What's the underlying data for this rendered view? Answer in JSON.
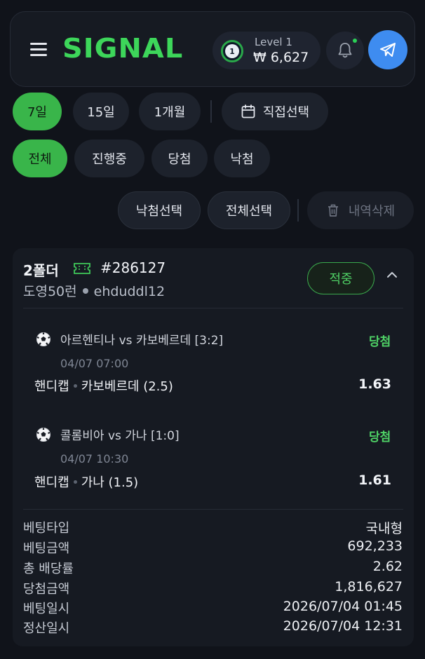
{
  "header": {
    "logo": "SIGNAL",
    "level_badge_number": "1",
    "level": "Level 1",
    "balance": "₩ 6,627",
    "accent_color": "#3dd65a"
  },
  "period_filters": [
    {
      "label": "7일",
      "active": true
    },
    {
      "label": "15일",
      "active": false
    },
    {
      "label": "1개월",
      "active": false
    }
  ],
  "custom_date_label": "직접선택",
  "status_filters": [
    {
      "label": "전체",
      "active": true
    },
    {
      "label": "진행중",
      "active": false
    },
    {
      "label": "당첨",
      "active": false
    },
    {
      "label": "낙첨",
      "active": false
    }
  ],
  "actions": {
    "select_lost": "낙첨선택",
    "select_all": "전체선택",
    "delete_history": "내역삭제"
  },
  "bet_card": {
    "title": "2폴더",
    "bet_id": "#286127",
    "nickname": "도영50런",
    "username": "ehduddl12",
    "status": "적중",
    "matches": [
      {
        "title": "아르헨티나 vs 카보베르데 [3:2]",
        "result": "당첨",
        "time": "04/07 07:00",
        "market": "핸디캡",
        "pick": "카보베르데 (2.5)",
        "odds": "1.63"
      },
      {
        "title": "콜롬비아 vs 가나 [1:0]",
        "result": "당첨",
        "time": "04/07 10:30",
        "market": "핸디캡",
        "pick": "가나 (1.5)",
        "odds": "1.61"
      }
    ],
    "details": [
      {
        "label": "베팅타입",
        "value": "국내형"
      },
      {
        "label": "베팅금액",
        "value": "692,233"
      },
      {
        "label": "총 배당률",
        "value": "2.62"
      },
      {
        "label": "당첨금액",
        "value": "1,816,627"
      },
      {
        "label": "베팅일시",
        "value": "2026/07/04 01:45"
      },
      {
        "label": "정산일시",
        "value": "2026/07/04 12:31"
      }
    ]
  }
}
